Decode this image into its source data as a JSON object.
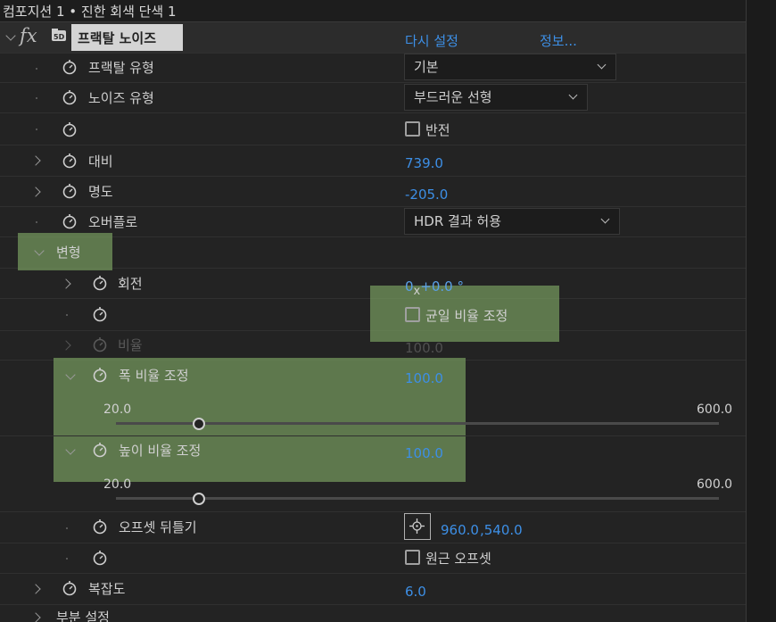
{
  "title": "컴포지션 1 • 진한 회색 단색 1",
  "effect": {
    "name": "프랙탈 노이즈",
    "fx_label": "fx",
    "reset": "다시 설정",
    "info": "정보..."
  },
  "props": {
    "fractal_type": {
      "label": "프랙탈 유형",
      "value": "기본"
    },
    "noise_type": {
      "label": "노이즈 유형",
      "value": "부드러운 선형"
    },
    "invert": {
      "label": "반전"
    },
    "contrast": {
      "label": "대비",
      "value": "739.0"
    },
    "brightness": {
      "label": "명도",
      "value": "-205.0"
    },
    "overflow": {
      "label": "오버플로",
      "value": "HDR 결과 허용"
    },
    "transform": {
      "label": "변형"
    },
    "rotation": {
      "label": "회전",
      "value": "0x+0.0 °",
      "value_rev": "0",
      "value_x": "x",
      "value_deg": "+0.0 °"
    },
    "uniform_scale": {
      "label": "균일 비율 조정"
    },
    "scale": {
      "label": "비율",
      "value": "100.0"
    },
    "scale_width": {
      "label": "폭 비율 조정",
      "value": "100.0",
      "min": "20.0",
      "max": "600.0",
      "level": 100
    },
    "scale_height": {
      "label": "높이 비율 조정",
      "value": "100.0",
      "min": "20.0",
      "max": "600.0",
      "level": 100
    },
    "offset_turbulence": {
      "label": "오프셋 뒤틀기",
      "x": "960.0",
      "y": ",540.0"
    },
    "perspective_offset": {
      "label": "원근 오프셋"
    },
    "complexity": {
      "label": "복잡도",
      "value": "6.0"
    },
    "sub_settings": {
      "label": "부분 설정"
    }
  },
  "colors": {
    "value_blue": "#3d8fe6",
    "highlight_green": "#769a5e"
  }
}
